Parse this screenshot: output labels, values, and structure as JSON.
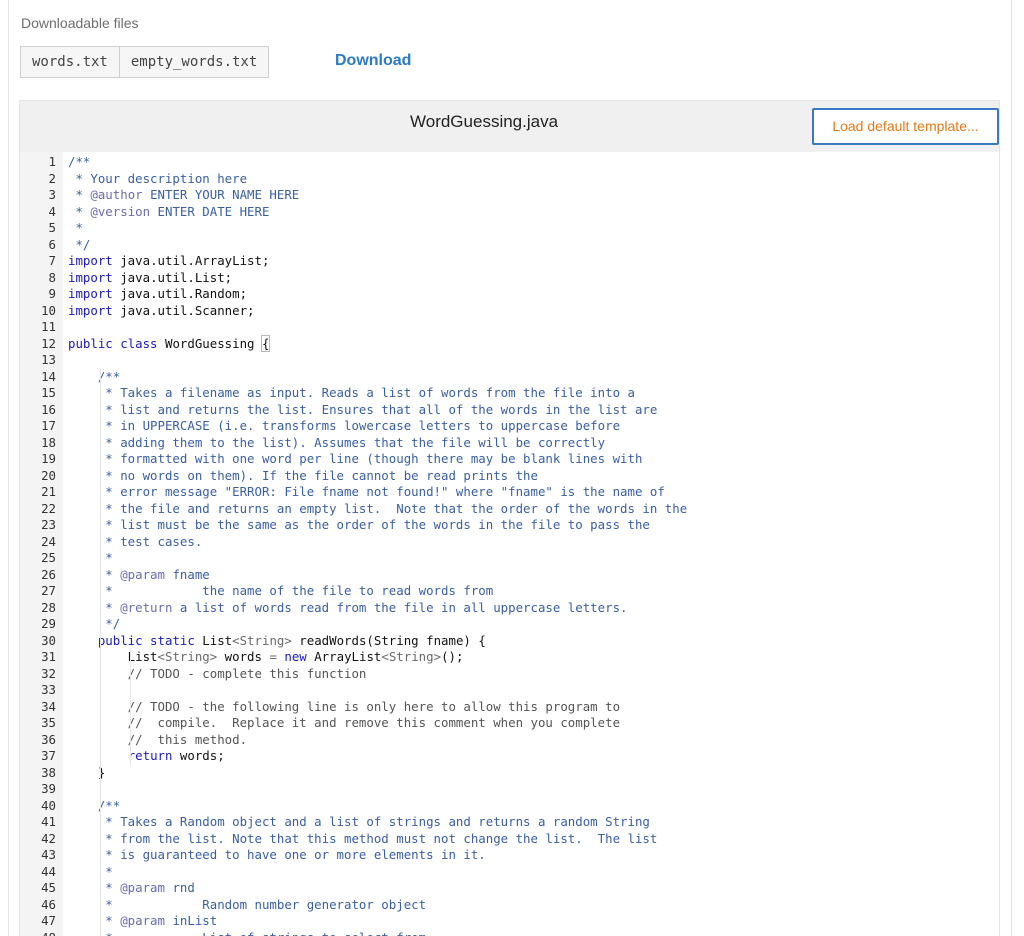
{
  "downloadable": {
    "title": "Downloadable files",
    "files": [
      "words.txt",
      "empty_words.txt"
    ],
    "download_label": "Download"
  },
  "editor": {
    "filename": "WordGuessing.java",
    "load_template_label": "Load default template...",
    "lines": [
      [
        [
          "cm",
          "/**"
        ]
      ],
      [
        [
          "cm",
          " * Your description here"
        ]
      ],
      [
        [
          "cm",
          " * "
        ],
        [
          "tg",
          "@author"
        ],
        [
          "cm",
          " ENTER YOUR NAME HERE"
        ]
      ],
      [
        [
          "cm",
          " * "
        ],
        [
          "tg",
          "@version"
        ],
        [
          "cm",
          " ENTER DATE HERE"
        ]
      ],
      [
        [
          "cm",
          " *"
        ]
      ],
      [
        [
          "cm",
          " */"
        ]
      ],
      [
        [
          "kw",
          "import"
        ],
        [
          "tx",
          " java.util.ArrayList;"
        ]
      ],
      [
        [
          "kw",
          "import"
        ],
        [
          "tx",
          " java.util.List;"
        ]
      ],
      [
        [
          "kw",
          "import"
        ],
        [
          "tx",
          " java.util.Random;"
        ]
      ],
      [
        [
          "kw",
          "import"
        ],
        [
          "tx",
          " java.util.Scanner;"
        ]
      ],
      [
        [
          "tx",
          ""
        ]
      ],
      [
        [
          "kw",
          "public class"
        ],
        [
          "tx",
          " WordGuessing "
        ],
        [
          "br",
          "{"
        ]
      ],
      [
        [
          "tx",
          ""
        ]
      ],
      [
        [
          "cm",
          "    /**"
        ]
      ],
      [
        [
          "cm",
          "     * Takes a filename as input. Reads a list of words from the file into a"
        ]
      ],
      [
        [
          "cm",
          "     * list and returns the list. Ensures that all of the words in the list are"
        ]
      ],
      [
        [
          "cm",
          "     * in UPPERCASE (i.e. transforms lowercase letters to uppercase before"
        ]
      ],
      [
        [
          "cm",
          "     * adding them to the list). Assumes that the file will be correctly"
        ]
      ],
      [
        [
          "cm",
          "     * formatted with one word per line (though there may be blank lines with"
        ]
      ],
      [
        [
          "cm",
          "     * no words on them). If the file cannot be read prints the"
        ]
      ],
      [
        [
          "cm",
          "     * error message \"ERROR: File fname not found!\" where \"fname\" is the name of"
        ]
      ],
      [
        [
          "cm",
          "     * the file and returns an empty list.  Note that the order of the words in the"
        ]
      ],
      [
        [
          "cm",
          "     * list must be the same as the order of the words in the file to pass the"
        ]
      ],
      [
        [
          "cm",
          "     * test cases."
        ]
      ],
      [
        [
          "cm",
          "     *"
        ]
      ],
      [
        [
          "cm",
          "     * "
        ],
        [
          "tg",
          "@param"
        ],
        [
          "cm",
          " fname"
        ]
      ],
      [
        [
          "cm",
          "     *            the name of the file to read words from"
        ]
      ],
      [
        [
          "cm",
          "     * "
        ],
        [
          "tg",
          "@return"
        ],
        [
          "cm",
          " a list of words read from the file in all uppercase letters."
        ]
      ],
      [
        [
          "cm",
          "     */"
        ]
      ],
      [
        [
          "tx",
          "    "
        ],
        [
          "kw",
          "public static"
        ],
        [
          "tx",
          " List"
        ],
        [
          "ty",
          "<String>"
        ],
        [
          "tx",
          " readWords(String fname) {"
        ]
      ],
      [
        [
          "tx",
          "        List"
        ],
        [
          "ty",
          "<String>"
        ],
        [
          "tx",
          " words "
        ],
        [
          "ty",
          "="
        ],
        [
          "tx",
          " "
        ],
        [
          "kw",
          "new"
        ],
        [
          "tx",
          " ArrayList"
        ],
        [
          "ty",
          "<String>"
        ],
        [
          "tx",
          "();"
        ]
      ],
      [
        [
          "ct",
          "        // TODO - complete this function"
        ]
      ],
      [
        [
          "tx",
          ""
        ]
      ],
      [
        [
          "ct",
          "        // TODO - the following line is only here to allow this program to"
        ]
      ],
      [
        [
          "ct",
          "        //  compile.  Replace it and remove this comment when you complete"
        ]
      ],
      [
        [
          "ct",
          "        //  this method."
        ]
      ],
      [
        [
          "tx",
          "        "
        ],
        [
          "kw",
          "return"
        ],
        [
          "tx",
          " words;"
        ]
      ],
      [
        [
          "tx",
          "    }"
        ]
      ],
      [
        [
          "tx",
          ""
        ]
      ],
      [
        [
          "cm",
          "    /**"
        ]
      ],
      [
        [
          "cm",
          "     * Takes a Random object and a list of strings and returns a random String"
        ]
      ],
      [
        [
          "cm",
          "     * from the list. Note that this method must not change the list.  The list"
        ]
      ],
      [
        [
          "cm",
          "     * is guaranteed to have one or more elements in it."
        ]
      ],
      [
        [
          "cm",
          "     *"
        ]
      ],
      [
        [
          "cm",
          "     * "
        ],
        [
          "tg",
          "@param"
        ],
        [
          "cm",
          " rnd"
        ]
      ],
      [
        [
          "cm",
          "     *            Random number generator object"
        ]
      ],
      [
        [
          "cm",
          "     * "
        ],
        [
          "tg",
          "@param"
        ],
        [
          "cm",
          " inList"
        ]
      ],
      [
        [
          "cm",
          "     *            List of strings to select from"
        ]
      ]
    ]
  }
}
